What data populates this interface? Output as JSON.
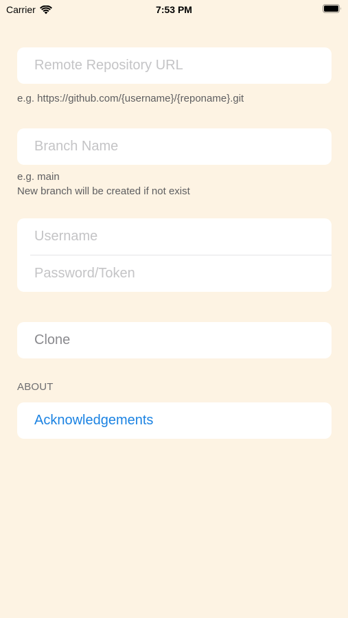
{
  "status_bar": {
    "carrier": "Carrier",
    "time": "7:53 PM",
    "wifi_icon": "wifi-icon",
    "battery_icon": "battery-icon"
  },
  "remote": {
    "placeholder": "Remote Repository URL",
    "value": "",
    "hint": "e.g. https://github.com/{username}/{reponame}.git"
  },
  "branch": {
    "placeholder": "Branch Name",
    "value": "",
    "hint_line1": "e.g. main",
    "hint_line2": "New branch will be created if not exist"
  },
  "credentials": {
    "username_placeholder": "Username",
    "username_value": "",
    "password_placeholder": "Password/Token",
    "password_value": ""
  },
  "actions": {
    "clone_label": "Clone"
  },
  "about": {
    "header": "ABOUT",
    "acknowledgements_label": "Acknowledgements"
  },
  "colors": {
    "background": "#fdf3e3",
    "card": "#ffffff",
    "link": "#1a82e2",
    "placeholder": "#c4c4c6",
    "disabled_text": "#8a8a8e"
  }
}
